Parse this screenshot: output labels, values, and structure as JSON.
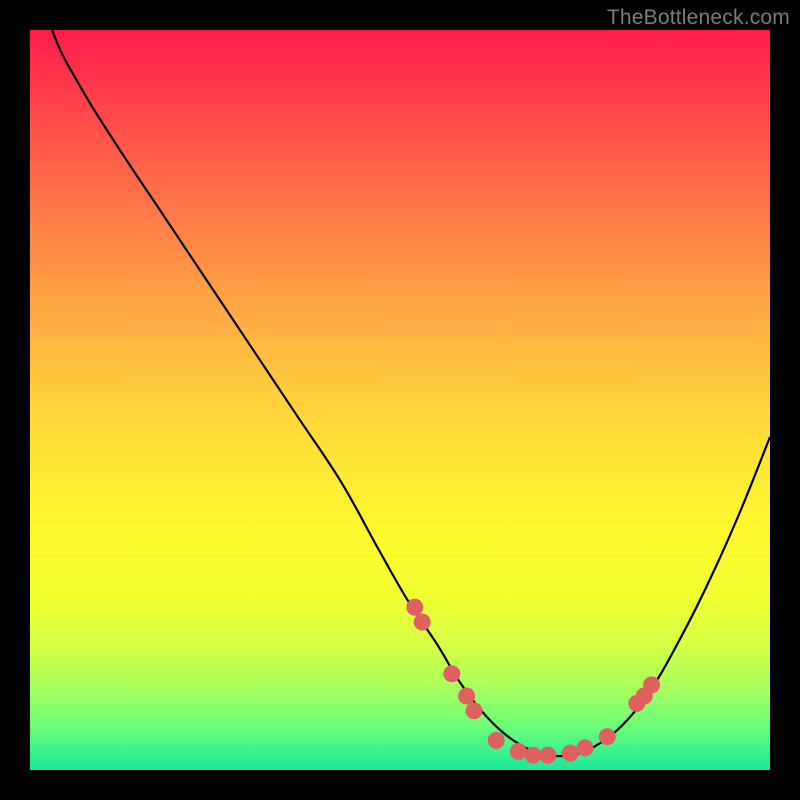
{
  "watermark": "TheBottleneck.com",
  "colors": {
    "curve_stroke": "#000000",
    "marker_fill": "#e06060",
    "background_black": "#000000"
  },
  "chart_data": {
    "type": "line",
    "title": "",
    "xlabel": "",
    "ylabel": "",
    "xlim": [
      0,
      100
    ],
    "ylim": [
      0,
      100
    ],
    "x": [
      0,
      3,
      7,
      12,
      18,
      24,
      30,
      36,
      42,
      47,
      51,
      55,
      58,
      61,
      64,
      67,
      70,
      73,
      76,
      80,
      84,
      88,
      92,
      96,
      100
    ],
    "values": [
      112,
      100,
      92,
      84,
      75,
      66,
      57,
      48,
      39,
      30,
      23,
      17,
      12,
      8,
      5,
      3,
      2,
      2,
      3,
      6,
      11,
      18,
      26,
      35,
      45
    ],
    "markers": [
      {
        "x": 52,
        "y": 22
      },
      {
        "x": 53,
        "y": 20
      },
      {
        "x": 57,
        "y": 13
      },
      {
        "x": 59,
        "y": 10
      },
      {
        "x": 60,
        "y": 8
      },
      {
        "x": 63,
        "y": 4
      },
      {
        "x": 66,
        "y": 2.5
      },
      {
        "x": 68,
        "y": 2
      },
      {
        "x": 70,
        "y": 2
      },
      {
        "x": 73,
        "y": 2.3
      },
      {
        "x": 75,
        "y": 3
      },
      {
        "x": 78,
        "y": 4.5
      },
      {
        "x": 82,
        "y": 9
      },
      {
        "x": 83,
        "y": 10
      },
      {
        "x": 84,
        "y": 11.5
      }
    ]
  }
}
